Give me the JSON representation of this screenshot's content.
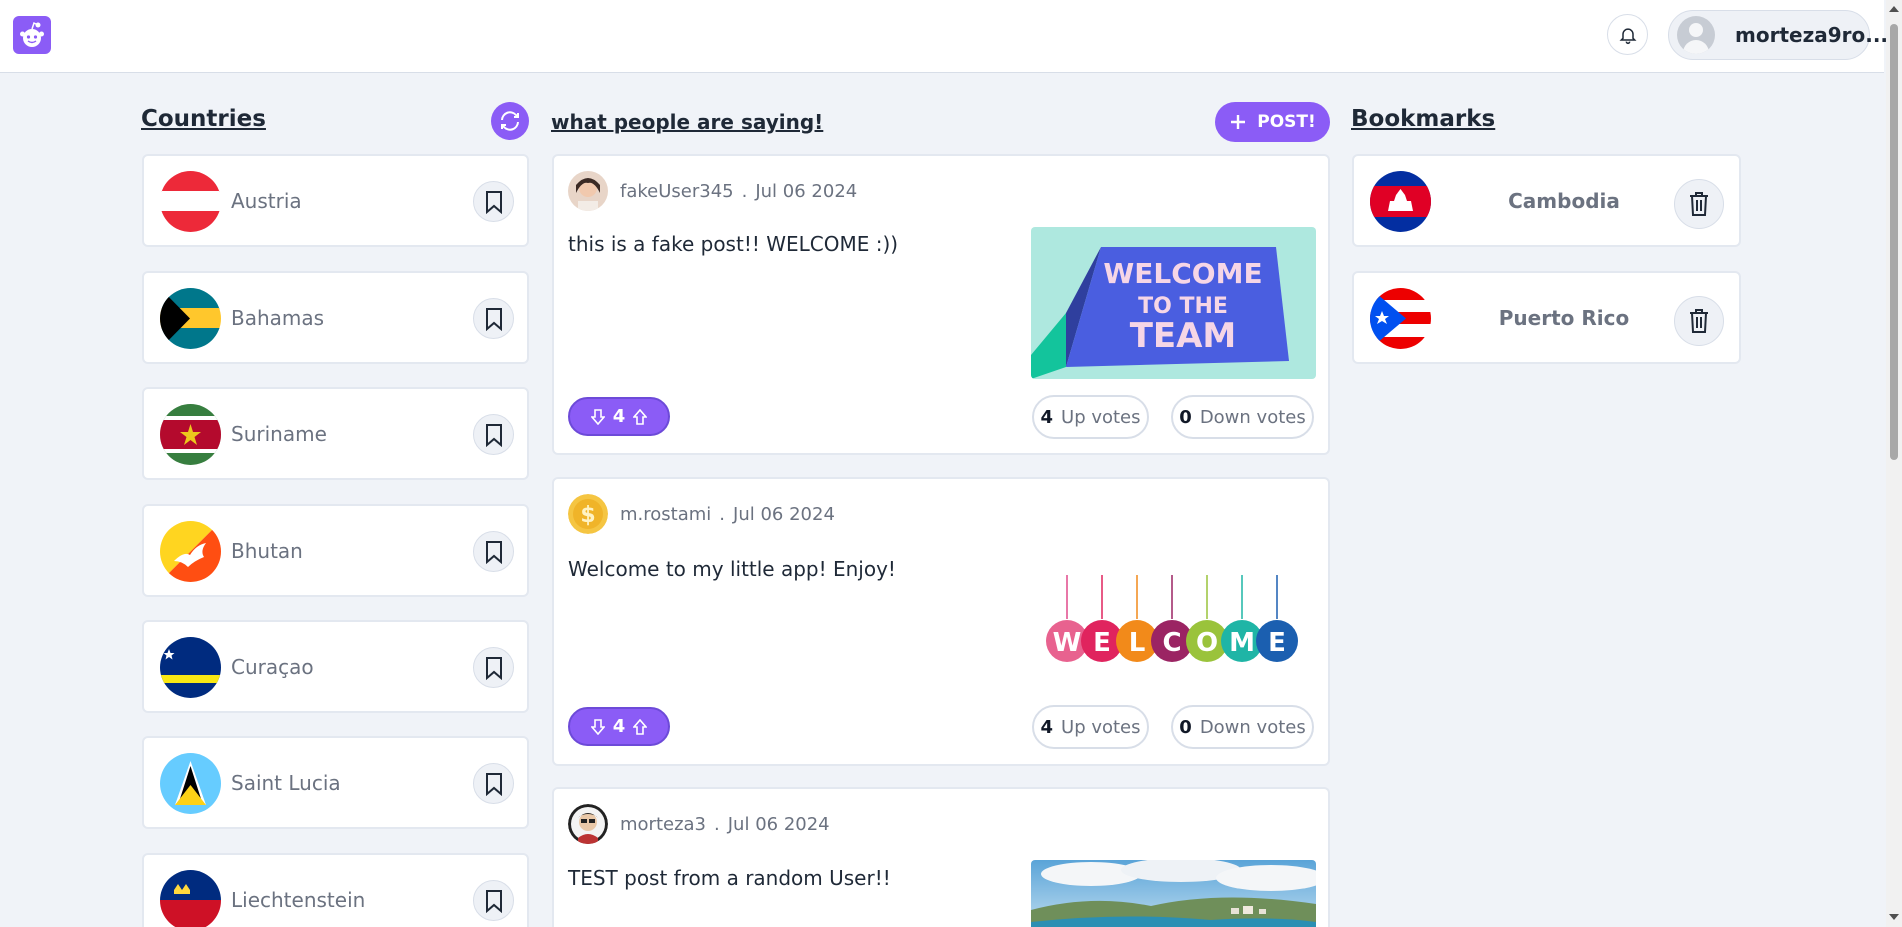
{
  "header": {
    "username": "morteza9ro..."
  },
  "countries": {
    "title": "Countries",
    "items": [
      {
        "name": "Austria"
      },
      {
        "name": "Bahamas"
      },
      {
        "name": "Suriname"
      },
      {
        "name": "Bhutan"
      },
      {
        "name": "Curaçao"
      },
      {
        "name": "Saint Lucia"
      },
      {
        "name": "Liechtenstein"
      }
    ]
  },
  "feed": {
    "title": "what people are saying!",
    "post_button": "POST!",
    "up_label": "Up votes",
    "down_label": "Down votes",
    "posts": [
      {
        "user": "fakeUser345",
        "sep": ".",
        "date": "Jul 06 2024",
        "text": "this is a fake post!! WELCOME :))",
        "score": "4",
        "up": "4",
        "down": "0",
        "image_text": [
          "WELCOME",
          "TO THE",
          "TEAM"
        ]
      },
      {
        "user": "m.rostami",
        "sep": ".",
        "date": "Jul 06 2024",
        "text": "Welcome to my little app! Enjoy!",
        "score": "4",
        "up": "4",
        "down": "0",
        "image_text": [
          "W",
          "E",
          "L",
          "C",
          "O",
          "M",
          "E"
        ]
      },
      {
        "user": "morteza3",
        "sep": ".",
        "date": "Jul 06 2024",
        "text": "TEST post from a random User!!"
      }
    ]
  },
  "bookmarks": {
    "title": "Bookmarks",
    "items": [
      {
        "name": "Cambodia"
      },
      {
        "name": "Puerto Rico"
      }
    ]
  },
  "colors": {
    "accent": "#8b5cf6",
    "background": "#f0f3f8"
  }
}
